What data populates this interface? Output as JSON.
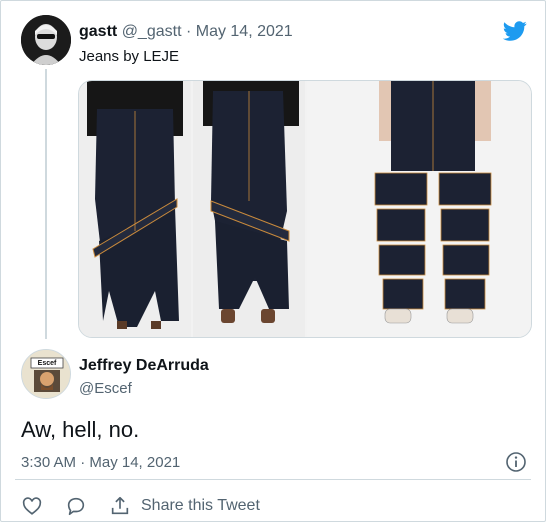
{
  "parent_tweet": {
    "display_name": "gastt",
    "handle_date": "@_gastt · May 14, 2021",
    "text": "Jeans by LEJE"
  },
  "reply_tweet": {
    "display_name": "Jeffrey DeArruda",
    "handle": "@Escef",
    "text": "Aw, hell, no.",
    "timestamp": "3:30 AM · May 14, 2021",
    "avatar_sign": "Escef"
  },
  "actions": {
    "share_label": "Share this Tweet"
  },
  "colors": {
    "twitter_blue": "#1d9bf0",
    "muted_text": "#536471",
    "border": "#cfd9de",
    "denim": "#1c2233",
    "stitching": "#c98a3c"
  },
  "icons": [
    "twitter-bird-icon",
    "info-icon",
    "reply-icon",
    "like-icon",
    "share-icon"
  ]
}
